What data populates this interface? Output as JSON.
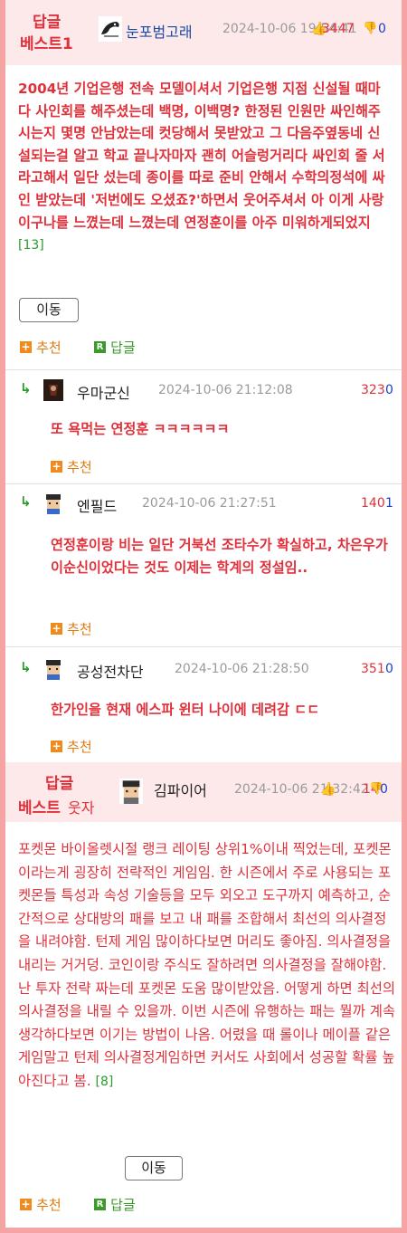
{
  "best1": {
    "badge_line1": "답글",
    "badge_line2": "베스트1",
    "nick": "눈포범고래",
    "date": "2024-10-06 19:54:41",
    "up": "3447",
    "down": "0",
    "body": "2004년 기업은행 전속 모델이셔서 기업은행 지점 신설될 때마다 사인회를 해주셨는데 백명, 이백명? 한정된 인원만 싸인해주시는지 몇명 안남았는데 컷당해서 못받았고 그 다음주옆동네 신설되는걸 알고 학교 끝나자마자 괜히 어슬렁거리다 싸인회 줄 서라고해서 일단 섰는데 종이를 따로 준비 안해서 수학의정석에 싸인 받았는데 '저번에도 오셨죠?'하면서 웃어주셔서 아 이게 사랑이구나를 느꼈는데 느꼈는데 연정훈이를 아주 미워하게되었지",
    "reply_count": "[13]",
    "move_label": "이동",
    "recommend_label": "추천",
    "reply_label": "답글"
  },
  "comments": [
    {
      "nick": "우마군신",
      "date": "2024-10-06 21:12:08",
      "up": "323",
      "down": "0",
      "body": "또 욕먹는 연정훈 ㅋㅋㅋㅋㅋㅋ",
      "recommend_label": "추천"
    },
    {
      "nick": "엔필드",
      "date": "2024-10-06 21:27:51",
      "up": "140",
      "down": "1",
      "body": "연정훈이랑 비는 일단 거북선 조타수가 확실하고, 차은우가 이순신이었다는 것도 이제는 학계의 정설임..",
      "recommend_label": "추천"
    },
    {
      "nick": "공성전차단",
      "date": "2024-10-06 21:28:50",
      "up": "351",
      "down": "0",
      "body": "한가인을 현재 에스파 윈터 나이에 데려감 ㄷㄷ",
      "recommend_label": "추천"
    }
  ],
  "best2": {
    "badge_line1": "답글",
    "badge_line2": "베스트",
    "badge_suffix": "웃자",
    "nick": "김파이어",
    "date": "2024-10-06 21:32:42",
    "up": "14",
    "down": "0",
    "body": "포켓몬 바이올렛시절 랭크 레이팅 상위1%이내 찍었는데, 포켓몬이라는게 굉장히 전략적인 게임임. 한 시즌에서 주로 사용되는 포켓몬들 특성과 속성 기술등을 모두 외오고 도구까지 예측하고, 순간적으로 상대방의 패를 보고 내 패를 조합해서 최선의 의사결정을 내려야함. 턴제 게임 많이하다보면 머리도 좋아짐. 의사결정을 내리는 거거덩. 코인이랑 주식도 잘하려면 의사결정을 잘해야함. 난 투자 전략 짜는데 포켓몬 도움 많이받았음. 어떻게 하면 최선의 의사결정을 내릴 수 있을까. 이번 시즌에 유행하는 패는 뭘까 계속생각하다보면 이기는 방법이 나옴. 어렸을 때 롤이나 메이플 같은 게임말고 턴제 의사결정게임하면 커서도 사회에서 성공할 확률 높아진다고 봄.",
    "reply_count": "[8]",
    "move_label": "이동",
    "recommend_label": "추천",
    "reply_label": "답글"
  }
}
